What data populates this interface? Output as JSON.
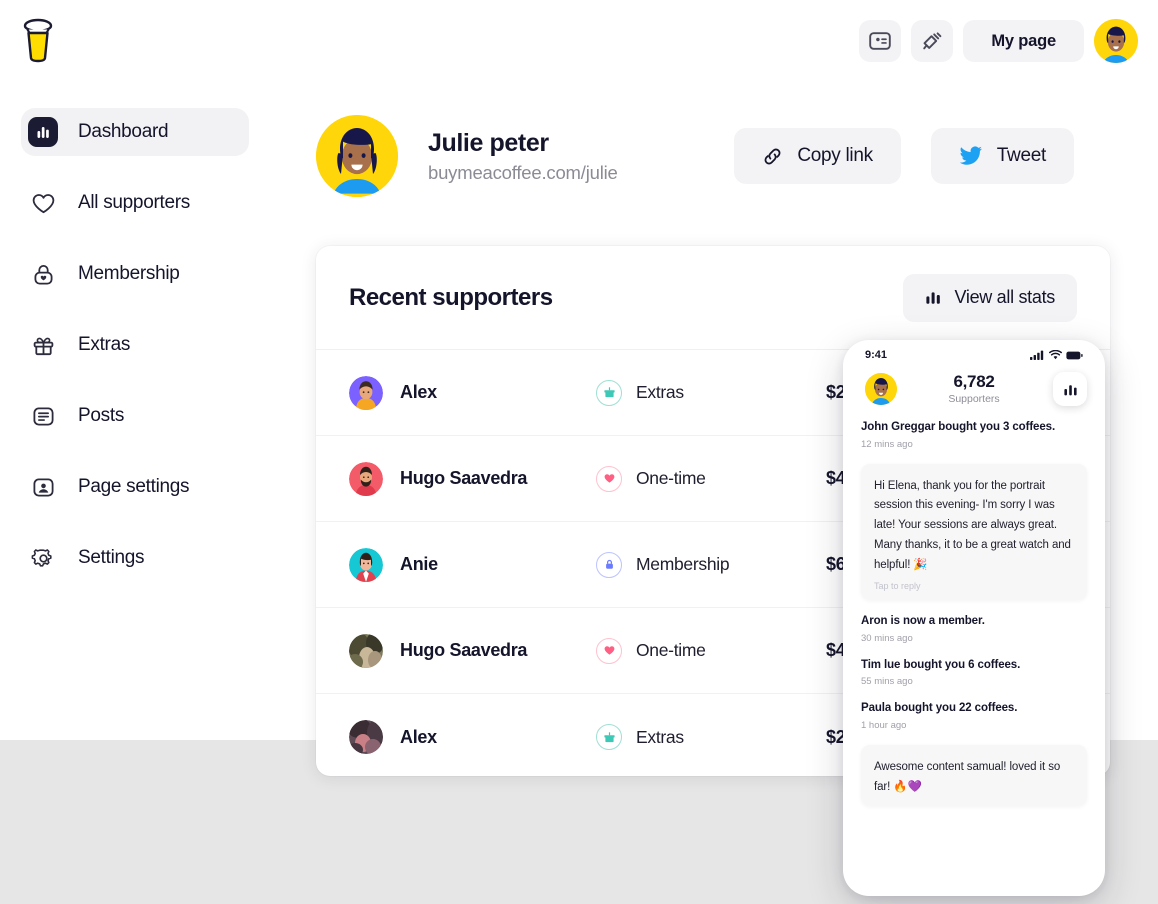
{
  "brand": {
    "logo_icon": "coffee-cup-icon",
    "accent_yellow": "#ffdd00",
    "ink": "#14142b"
  },
  "topbar": {
    "icons": [
      {
        "name": "membership-card-icon",
        "label": ""
      },
      {
        "name": "megaphone-icon",
        "label": ""
      }
    ],
    "my_page_label": "My page",
    "avatar_name": "user-avatar"
  },
  "sidebar": {
    "items": [
      {
        "label": "Dashboard",
        "icon": "bar-chart-icon",
        "active": true
      },
      {
        "label": "All supporters",
        "icon": "heart-icon",
        "active": false
      },
      {
        "label": "Membership",
        "icon": "lock-heart-icon",
        "active": false
      },
      {
        "label": "Extras",
        "icon": "gift-icon",
        "active": false
      },
      {
        "label": "Posts",
        "icon": "post-list-icon",
        "active": false
      },
      {
        "label": "Page settings",
        "icon": "user-card-icon",
        "active": false
      },
      {
        "label": "Settings",
        "icon": "gear-icon",
        "active": false
      }
    ]
  },
  "profile": {
    "name": "Julie peter",
    "url": "buymeacoffee.com/julie",
    "copy_link_label": "Copy link",
    "tweet_label": "Tweet",
    "twitter_color": "#1da1f2"
  },
  "supporters_card": {
    "title": "Recent supporters",
    "view_all_label": "View all stats",
    "rows": [
      {
        "name": "Alex",
        "type": "Extras",
        "type_icon": "gift-icon",
        "type_color": "#3ec9b6",
        "amount": "$25",
        "avatar_color": "#7b61ff"
      },
      {
        "name": "Hugo Saavedra",
        "type": "One-time",
        "type_icon": "heart-icon",
        "type_color": "#ff5f82",
        "amount": "$40",
        "avatar_color": "#f45b69"
      },
      {
        "name": "Anie",
        "type": "Membership",
        "type_icon": "lock-icon",
        "type_color": "#6b7bff",
        "amount": "$60",
        "avatar_color": "#16c7d4"
      },
      {
        "name": "Hugo Saavedra",
        "type": "One-time",
        "type_icon": "heart-icon",
        "type_color": "#ff5f82",
        "amount": "$40",
        "avatar_color": "#8d8566"
      },
      {
        "name": "Alex",
        "type": "Extras",
        "type_icon": "gift-icon",
        "type_color": "#3ec9b6",
        "amount": "$25",
        "avatar_color": "#6b5561"
      }
    ]
  },
  "phone": {
    "status_time": "9:41",
    "supporters_count": "6,782",
    "supporters_label": "Supporters",
    "stats_icon": "bar-chart-icon",
    "feed": [
      {
        "kind": "notification",
        "title": "John Greggar bought you 3 coffees.",
        "time": "12 mins ago"
      },
      {
        "kind": "bubble",
        "text": "Hi Elena, thank you for the portrait session this evening- I'm sorry I was late! Your sessions are always great. Many thanks, it to be a great watch and helpful! 🎉",
        "reply": "Tap to reply"
      },
      {
        "kind": "notification",
        "title": "Aron is now a member.",
        "time": "30 mins ago"
      },
      {
        "kind": "notification",
        "title": "Tim lue bought you 6 coffees.",
        "time": "55 mins ago"
      },
      {
        "kind": "notification",
        "title": "Paula bought you 22 coffees.",
        "time": "1 hour ago"
      },
      {
        "kind": "bubble",
        "text": "Awesome content samual! loved it so far! 🔥💜",
        "reply": ""
      }
    ]
  }
}
